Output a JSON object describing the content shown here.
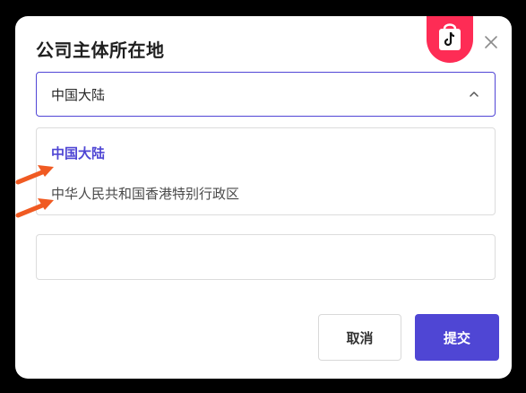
{
  "dialog": {
    "title": "公司主体所在地",
    "close_icon": "close-icon",
    "badge_icon": "shopping-bag-tiktok-icon",
    "badge_color": "#fe2c55"
  },
  "select": {
    "value": "中国大陆",
    "icon": "chevron-up-icon",
    "accent": "#4f46d4"
  },
  "dropdown": {
    "options": [
      {
        "label": "中国大陆",
        "selected": true
      },
      {
        "label": "中华人民共和国香港特别行政区",
        "selected": false
      }
    ]
  },
  "text_input": {
    "value": "",
    "placeholder": ""
  },
  "footer": {
    "cancel_label": "取消",
    "submit_label": "提交"
  },
  "annotations": {
    "arrow_color": "#f05a22",
    "arrow_icon": "arrow-pointer-icon"
  }
}
